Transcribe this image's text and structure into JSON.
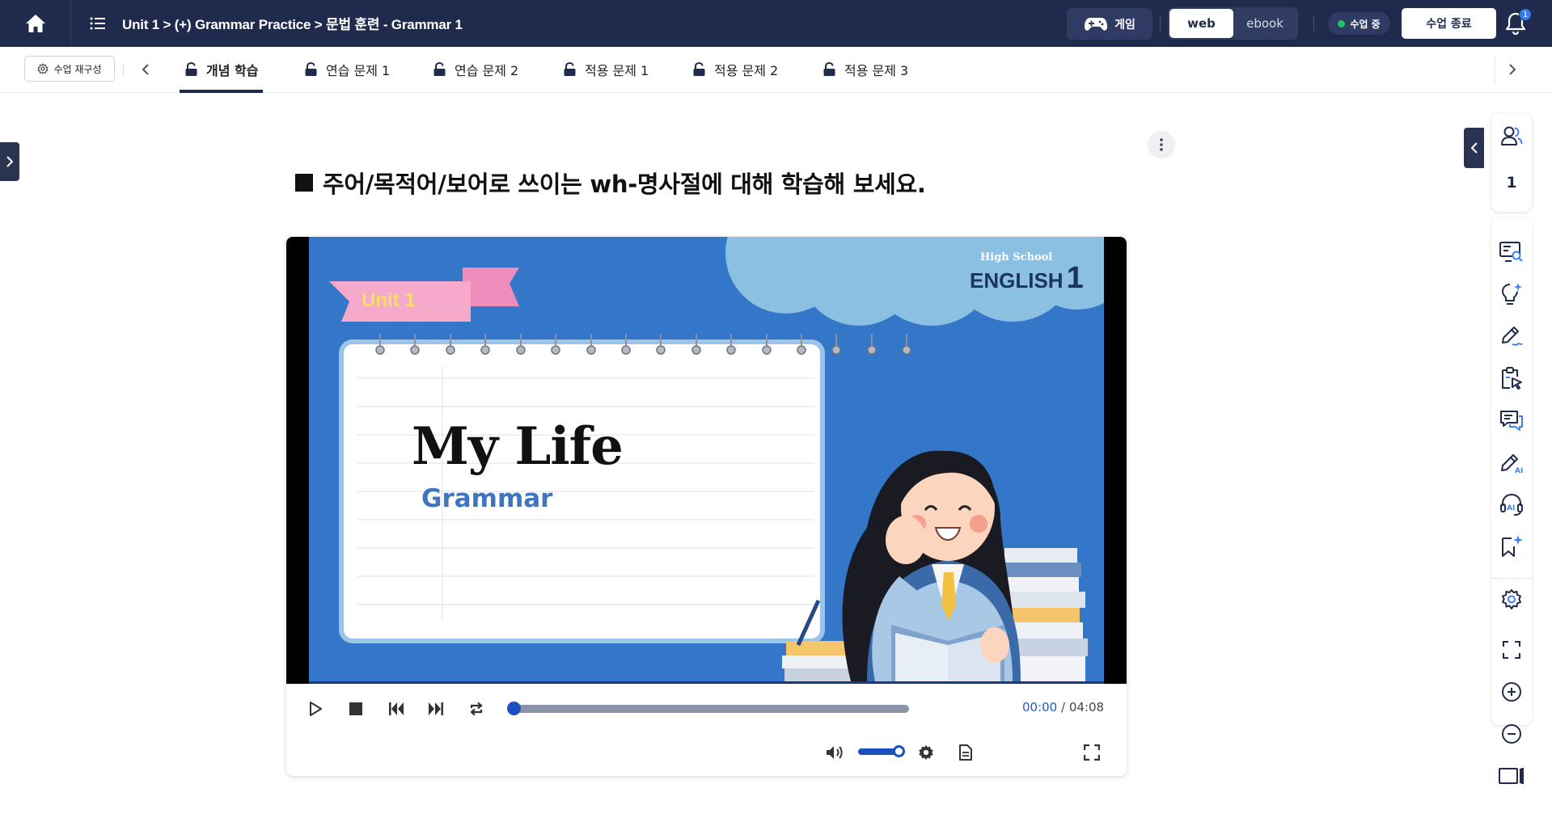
{
  "topbar": {
    "breadcrumb": "Unit 1 > (+) Grammar Practice > 문법 훈련 - Grammar 1",
    "game_label": "게임",
    "mode_web": "web",
    "mode_ebook": "ebook",
    "status": "수업 중",
    "end_class": "수업 종료",
    "notification_count": "1"
  },
  "tabs": {
    "restructure": "수업 재구성",
    "items": [
      {
        "label": "개념 학습",
        "active": true
      },
      {
        "label": "연습 문제 1"
      },
      {
        "label": "연습 문제 2"
      },
      {
        "label": "적용 문제 1"
      },
      {
        "label": "적용 문제 2"
      },
      {
        "label": "적용 문제 3"
      }
    ]
  },
  "content": {
    "question": "주어/목적어/보어로 쓰이는 wh-명사절에 대해 학습해 보세요."
  },
  "video": {
    "slide": {
      "high_school": "High School",
      "english": "ENGLISH",
      "english_num": "1",
      "unit": "Unit 1",
      "title": "My Life",
      "subtitle": "Grammar"
    },
    "progress": 0.0,
    "current_time": "00:00",
    "time_separator": "/",
    "duration": "04:08",
    "volume": 1.0
  },
  "sidebar": {
    "student_count": "1"
  },
  "colors": {
    "topbar_bg": "#1f2a4d",
    "accent_blue": "#1d4fbf",
    "slide_blue": "#3476c7",
    "status_green": "#22c55e"
  }
}
